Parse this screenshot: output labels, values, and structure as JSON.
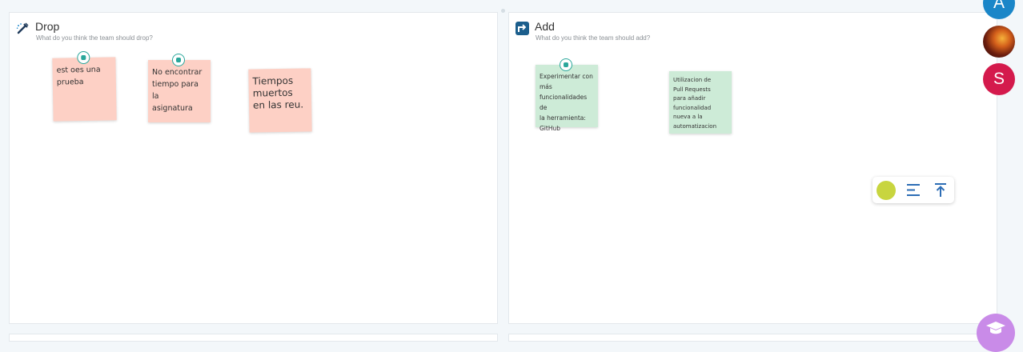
{
  "columns": [
    {
      "title": "Drop",
      "subtitle": "What do you think the team should drop?",
      "icon": "drop-icon",
      "notes": [
        {
          "text": "est oes una\nprueba",
          "color": "#fdd0c5"
        },
        {
          "text": "No encontrar\ntiempo para la\nasignatura",
          "color": "#fdd0c5"
        },
        {
          "text": "Tiempos\nmuertos\nen las reu.",
          "color": "#fdd0c5"
        }
      ]
    },
    {
      "title": "Add",
      "subtitle": "What do you think the team should add?",
      "icon": "add-icon",
      "notes": [
        {
          "text": "Experimentar con\nmás\nfuncionalidades de\nla herramienta:\nGitHub",
          "color": "#cdebd7"
        },
        {
          "text": "Utilizacion de\nPull Requests\npara añadir\nfuncionalidad\nnueva a la\nautomatizacion",
          "color": "#cdebd7"
        }
      ]
    }
  ],
  "toolbar": {
    "color_swatch": "#c8d53f",
    "icons": [
      "align-left-icon",
      "send-to-top-icon"
    ]
  },
  "avatars": [
    {
      "initial": "A",
      "color": "#1a86c8"
    },
    {
      "initial": "",
      "color": "photo"
    },
    {
      "initial": "S",
      "color": "#d41a4c"
    }
  ],
  "help_button": {
    "icon": "graduation-cap-icon",
    "color": "#c98be8"
  }
}
